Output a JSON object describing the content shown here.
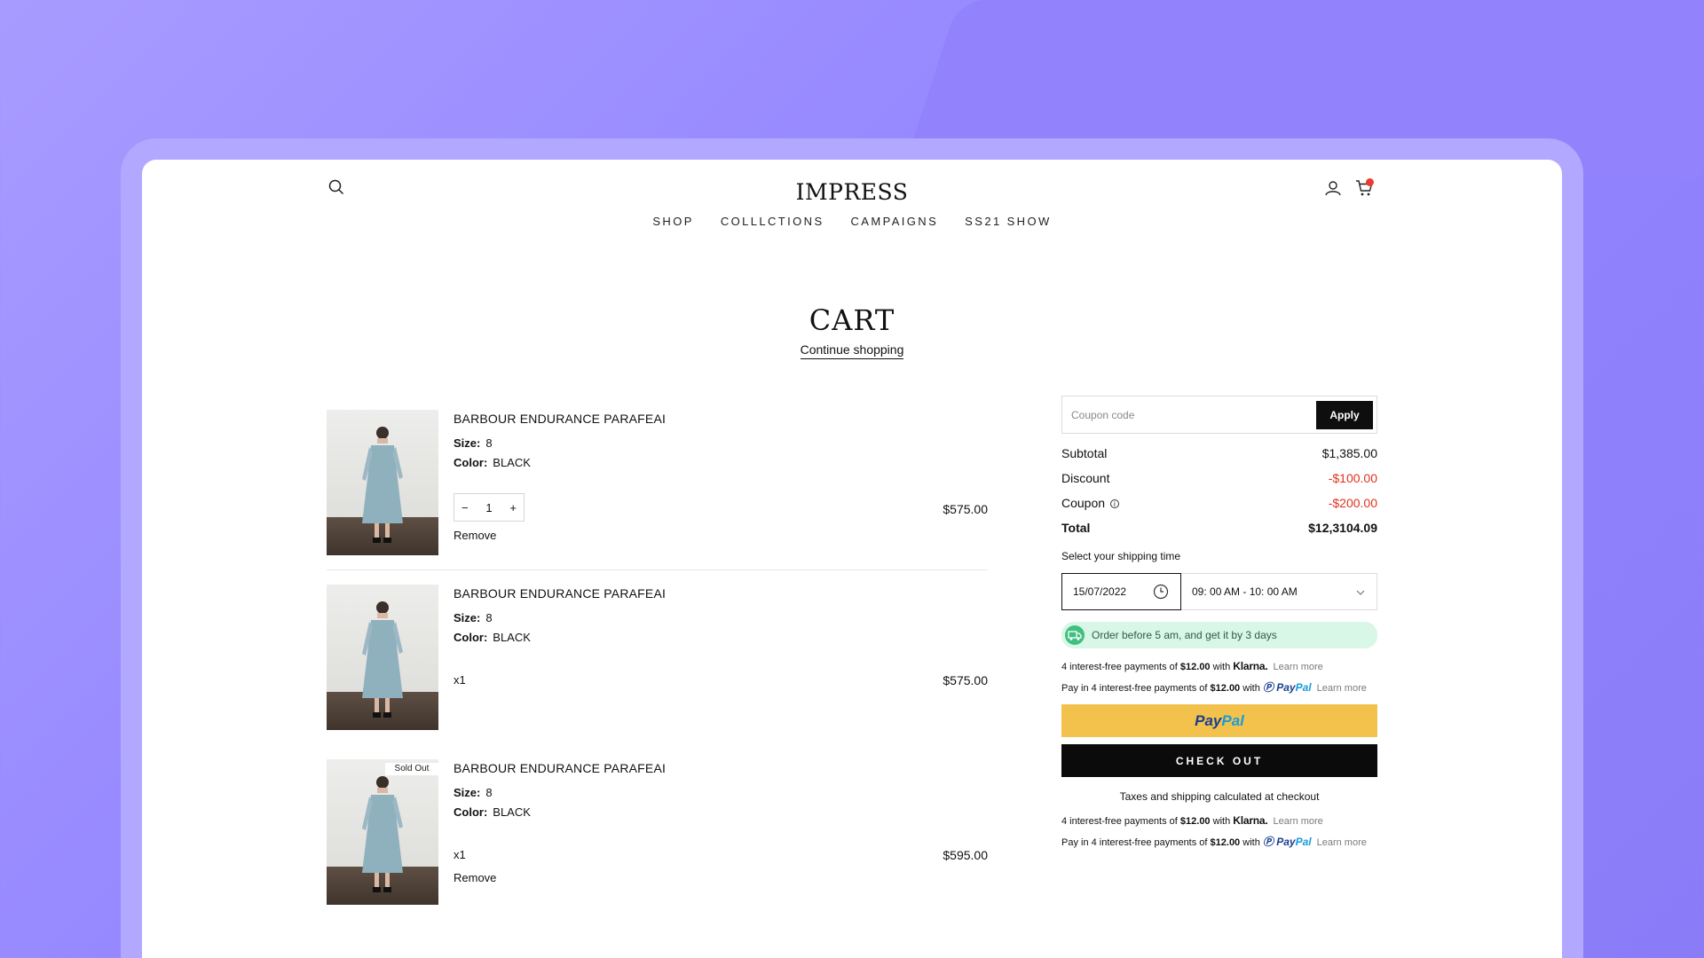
{
  "header": {
    "logo": "IMPRESS",
    "nav": [
      "SHOP",
      "COLLLCTIONS",
      "CAMPAIGNS",
      "SS21 SHOW"
    ]
  },
  "page": {
    "title": "CART",
    "continue": "Continue shopping"
  },
  "items": [
    {
      "name": "BARBOUR ENDURANCE PARAFEAI",
      "size_label": "Size:",
      "size": "8",
      "color_label": "Color:",
      "color": "BLACK",
      "qty": "1",
      "minus": "−",
      "plus": "+",
      "remove": "Remove",
      "price": "$575.00"
    },
    {
      "name": "BARBOUR ENDURANCE PARAFEAI",
      "size_label": "Size:",
      "size": "8",
      "color_label": "Color:",
      "color": "BLACK",
      "qty_text": "x1",
      "price": "$575.00"
    },
    {
      "name": "BARBOUR ENDURANCE PARAFEAI",
      "badge": "Sold Out",
      "size_label": "Size:",
      "size": "8",
      "color_label": "Color:",
      "color": "BLACK",
      "qty_text": "x1",
      "remove": "Remove",
      "price": "$595.00"
    }
  ],
  "summary": {
    "coupon_placeholder": "Coupon code",
    "apply": "Apply",
    "subtotal_label": "Subtotal",
    "subtotal": "$1,385.00",
    "discount_label": "Discount",
    "discount": "-$100.00",
    "coupon_label": "Coupon",
    "coupon_info": "i",
    "coupon_value": "-$200.00",
    "total_label": "Total",
    "total": "$12,3104.09",
    "shipping_label": "Select your shipping time",
    "date": "15/07/2022",
    "time": "09: 00 AM - 10: 00 AM",
    "notice": "Order before 5 am, and get it by 3 days",
    "installments_pre": "4 interest-free payments of",
    "installments_amount": "$12.00",
    "installments_with": "with",
    "klarna": "Klarna.",
    "paypal_pre": "Pay in 4 interest-free payments of",
    "paypal_brand_a": "Pay",
    "paypal_brand_b": "Pal",
    "learn_more": "Learn more",
    "paypal_btn_a": "Pay",
    "paypal_btn_b": "Pal",
    "checkout": "CHECK OUT",
    "taxes": "Taxes and shipping calculated at checkout"
  },
  "colors": {
    "accent_red": "#e0321f",
    "paypal_yellow": "#f3c24d",
    "notice_green": "#d9f7e6",
    "background_purple": "#9486ff"
  }
}
